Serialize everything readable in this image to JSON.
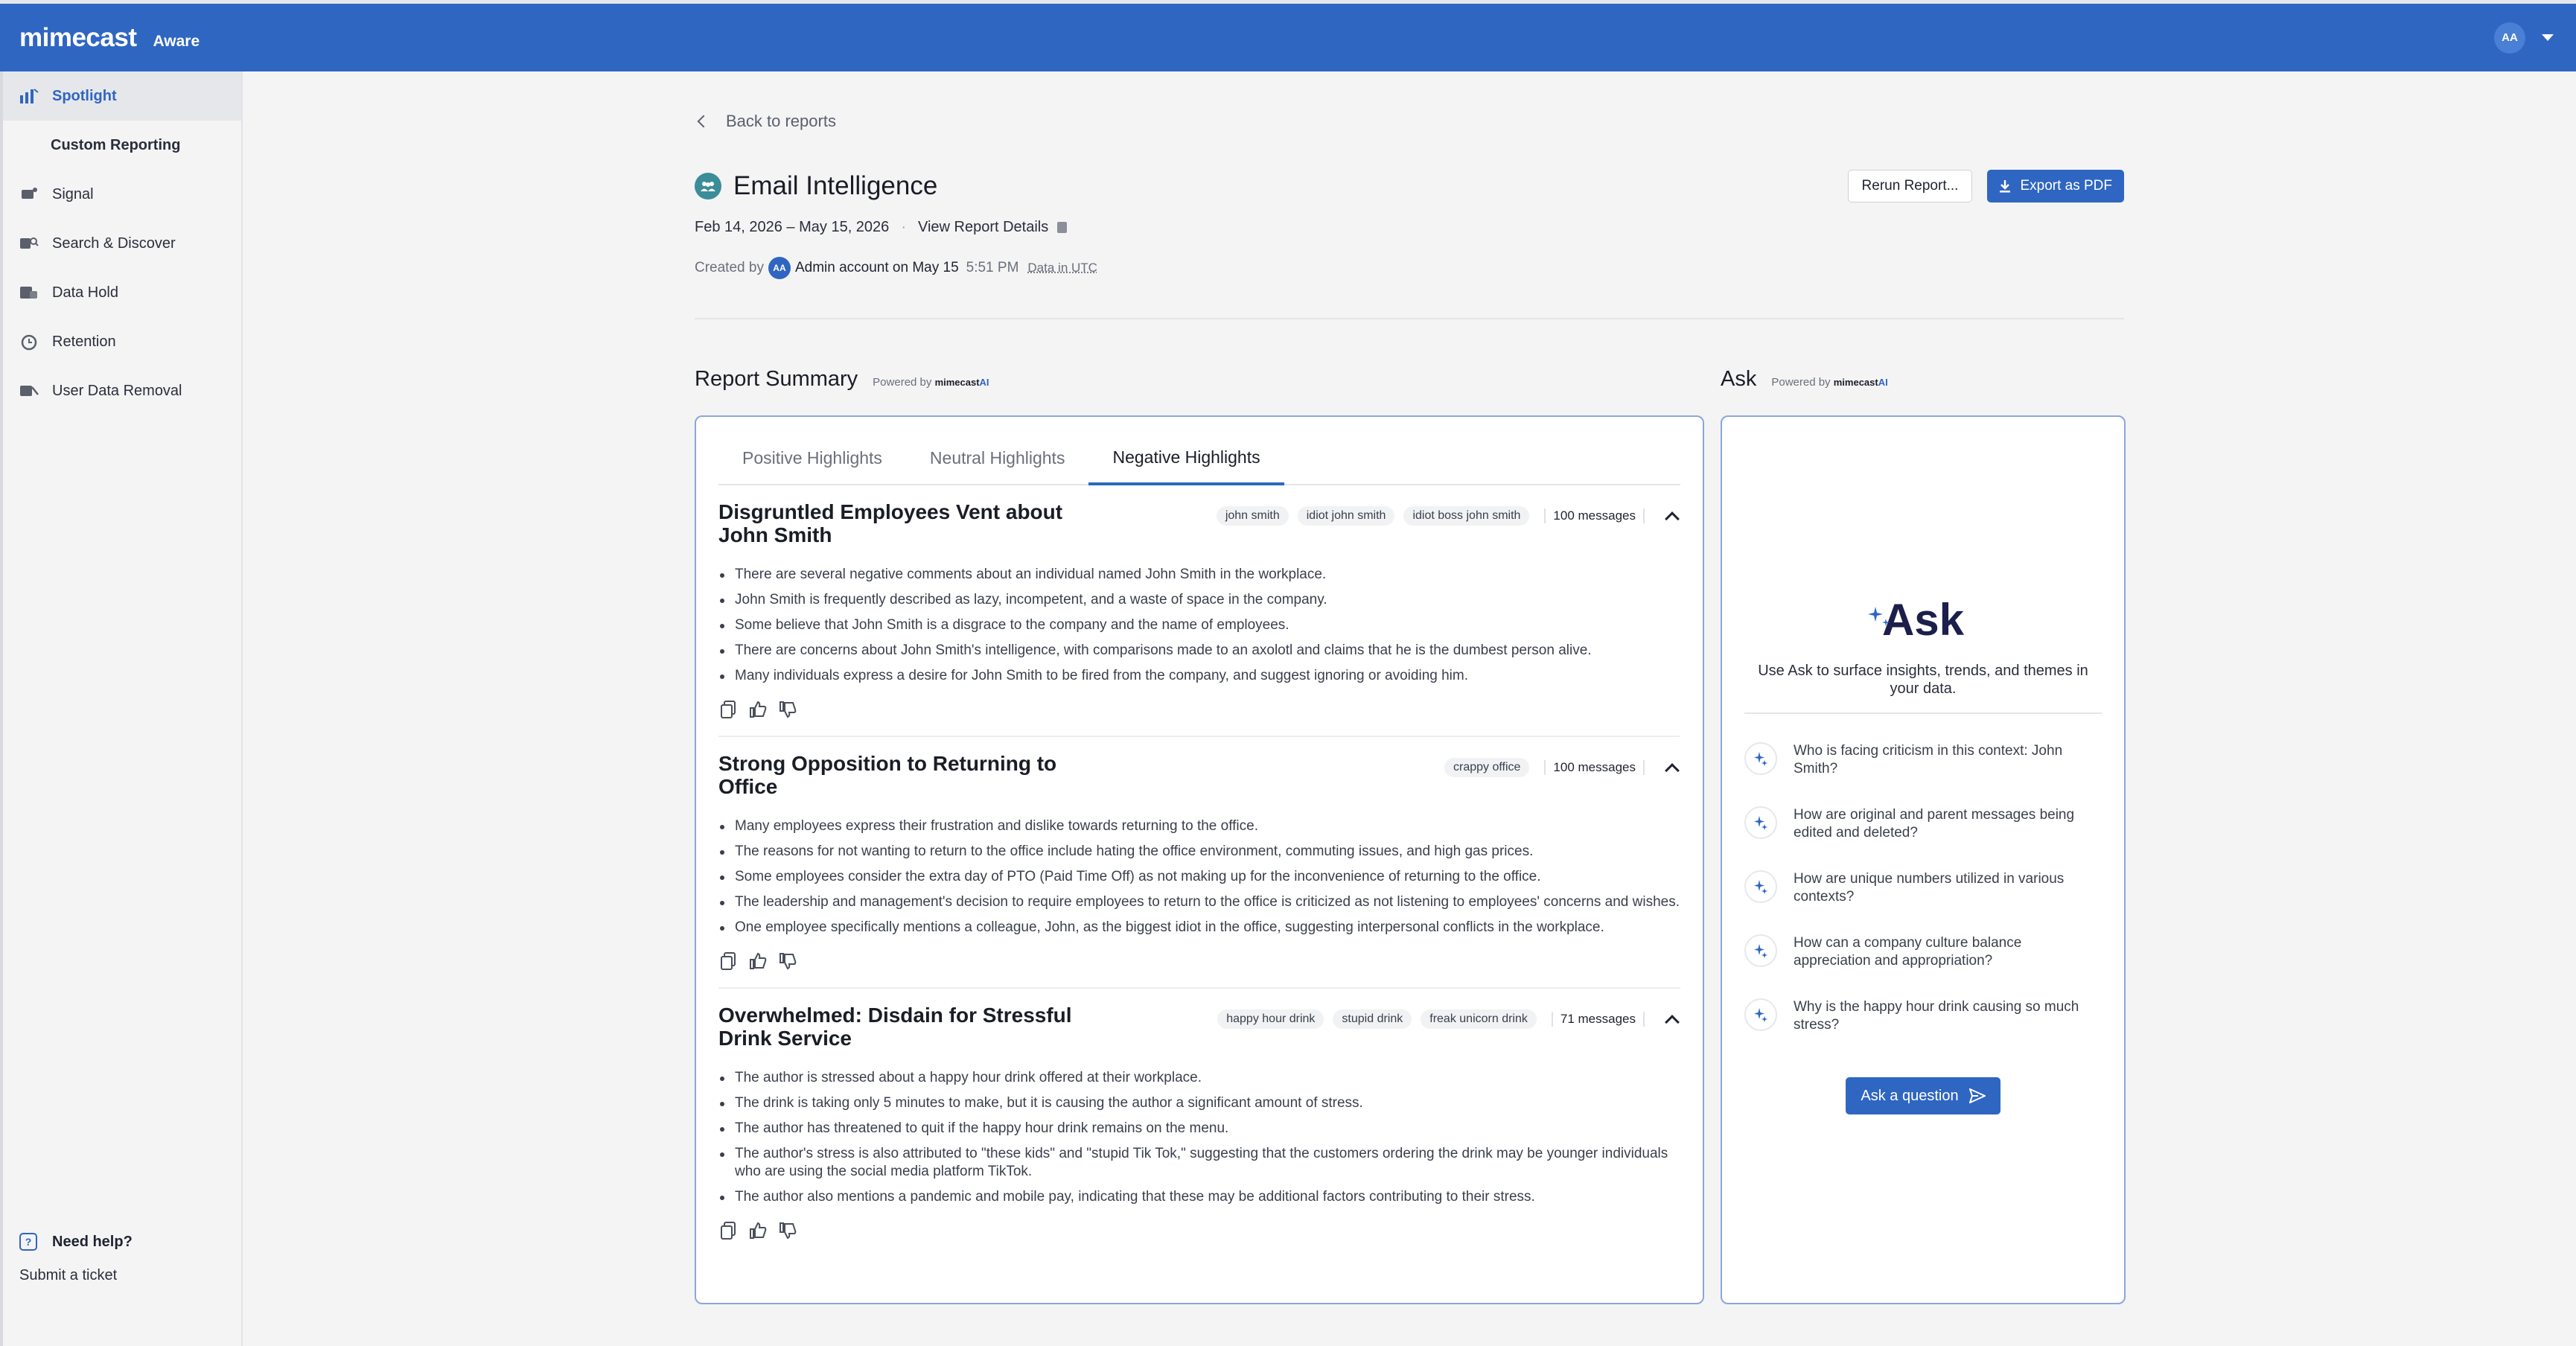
{
  "topbar": {
    "brand": "mimecast",
    "product": "Aware",
    "avatar": "AA"
  },
  "sidebar": {
    "items": [
      {
        "label": "Spotlight"
      },
      {
        "label": "Custom Reporting"
      },
      {
        "label": "Signal"
      },
      {
        "label": "Search & Discover"
      },
      {
        "label": "Data Hold"
      },
      {
        "label": "Retention"
      },
      {
        "label": "User Data Removal"
      }
    ],
    "help_title": "Need help?",
    "help_link": "Submit a ticket"
  },
  "header": {
    "back": "Back to reports",
    "title": "Email Intelligence",
    "rerun": "Rerun Report...",
    "export": "Export as PDF",
    "date_range": "Feb 14, 2026 – May 15, 2026",
    "details_link": "View Report Details",
    "created_by": "Created by",
    "creator_avatar": "AA",
    "creator": "Admin account on May 15",
    "time": "5:51 PM",
    "utc": "Data in UTC"
  },
  "summary": {
    "title": "Report Summary",
    "powered": "Powered by",
    "brand": "mimecast",
    "ai": "AI",
    "tabs": [
      "Positive Highlights",
      "Neutral Highlights",
      "Negative Highlights"
    ],
    "highlights": [
      {
        "title": "Disgruntled Employees Vent about John Smith",
        "tags": [
          "john smith",
          "idiot john smith",
          "idiot boss john smith"
        ],
        "messages": "100 messages",
        "bullets": [
          "There are several negative comments about an individual named John Smith in the workplace.",
          "John Smith is frequently described as lazy, incompetent, and a waste of space in the company.",
          "Some believe that John Smith is a disgrace to the company and the name of employees.",
          "There are concerns about John Smith's intelligence, with comparisons made to an axolotl and claims that he is the dumbest person alive.",
          "Many individuals express a desire for John Smith to be fired from the company, and suggest ignoring or avoiding him."
        ]
      },
      {
        "title": "Strong Opposition to Returning to Office",
        "tags": [
          "crappy office"
        ],
        "messages": "100 messages",
        "bullets": [
          "Many employees express their frustration and dislike towards returning to the office.",
          "The reasons for not wanting to return to the office include hating the office environment, commuting issues, and high gas prices.",
          "Some employees consider the extra day of PTO (Paid Time Off) as not making up for the inconvenience of returning to the office.",
          "The leadership and management's decision to require employees to return to the office is criticized as not listening to employees' concerns and wishes.",
          "One employee specifically mentions a colleague, John, as the biggest idiot in the office, suggesting interpersonal conflicts in the workplace."
        ]
      },
      {
        "title": "Overwhelmed: Disdain for Stressful Drink Service",
        "tags": [
          "happy hour drink",
          "stupid drink",
          "freak unicorn drink"
        ],
        "messages": "71 messages",
        "bullets": [
          "The author is stressed about a happy hour drink offered at their workplace.",
          "The drink is taking only 5 minutes to make, but it is causing the author a significant amount of stress.",
          "The author has threatened to quit if the happy hour drink remains on the menu.",
          "The author's stress is also attributed to \"these kids\" and \"stupid Tik Tok,\" suggesting that the customers ordering the drink may be younger individuals who are using the social media platform TikTok.",
          "The author also mentions a pandemic and mobile pay, indicating that these may be additional factors contributing to their stress."
        ]
      }
    ]
  },
  "ask": {
    "title": "Ask",
    "powered": "Powered by",
    "brand": "mimecast",
    "ai": "AI",
    "logo": "Ask",
    "description": "Use Ask to surface insights, trends, and themes in your data.",
    "questions": [
      "Who is facing criticism in this context: John Smith?",
      "How are original and parent messages being edited and deleted?",
      "How are unique numbers utilized in various contexts?",
      "How can a company culture balance appreciation and appropriation?",
      "Why is the happy hour drink causing so much stress?"
    ],
    "button": "Ask a question"
  },
  "colors": {
    "brand_blue": "#2f66c2",
    "card_border": "#8aa6dc"
  }
}
